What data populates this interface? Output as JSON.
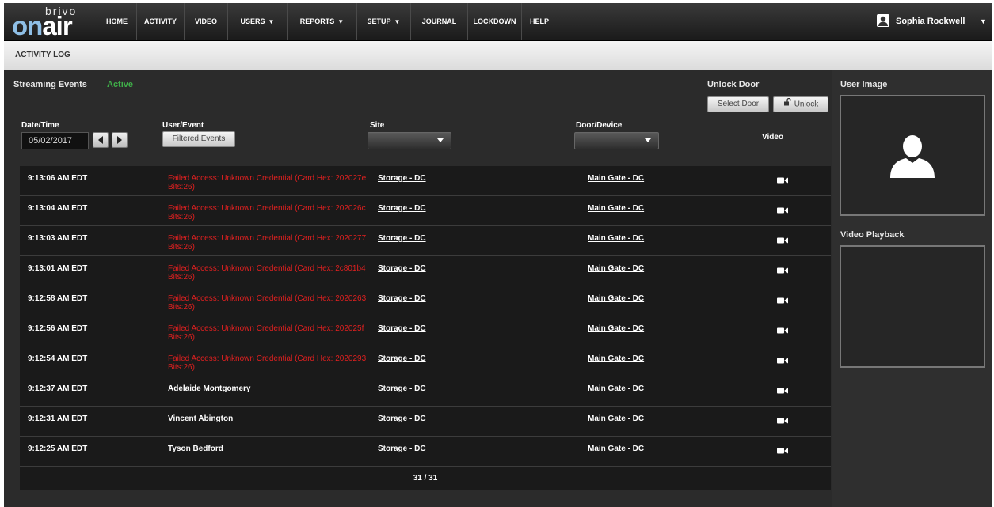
{
  "nav": {
    "brand_top": "brivo",
    "brand_on": "on",
    "brand_air": "air",
    "items": [
      {
        "label": "HOME",
        "caret": ""
      },
      {
        "label": "ACTIVITY",
        "caret": ""
      },
      {
        "label": "VIDEO",
        "caret": ""
      },
      {
        "label": "USERS",
        "caret": "▼"
      },
      {
        "label": "REPORTS",
        "caret": "▼"
      },
      {
        "label": "SETUP",
        "caret": "▼"
      },
      {
        "label": "JOURNAL",
        "caret": ""
      },
      {
        "label": "LOCKDOWN",
        "caret": ""
      },
      {
        "label": "HELP",
        "caret": ""
      }
    ],
    "user_name": "Sophia Rockwell",
    "user_caret": "▼"
  },
  "page": {
    "title": "ACTIVITY LOG"
  },
  "streaming": {
    "label": "Streaming Events",
    "status": "Active"
  },
  "unlock": {
    "title": "Unlock Door",
    "select_label": "Select Door",
    "unlock_label": "Unlock"
  },
  "filters": {
    "date_label": "Date/Time",
    "date_value": "05/02/2017",
    "user_event_label": "User/Event",
    "filtered_label": "Filtered Events",
    "site_label": "Site",
    "door_label": "Door/Device",
    "video_label": "Video"
  },
  "rows": [
    {
      "time": "9:13:06 AM EDT",
      "event": "Failed Access: Unknown Credential (Card Hex: 202027e Bits:26)",
      "type": "failed",
      "site": "Storage - DC",
      "door": "Main Gate - DC"
    },
    {
      "time": "9:13:04 AM EDT",
      "event": "Failed Access: Unknown Credential (Card Hex: 202026c Bits:26)",
      "type": "failed",
      "site": "Storage - DC",
      "door": "Main Gate - DC"
    },
    {
      "time": "9:13:03 AM EDT",
      "event": "Failed Access: Unknown Credential (Card Hex: 2020277 Bits:26)",
      "type": "failed",
      "site": "Storage - DC",
      "door": "Main Gate - DC"
    },
    {
      "time": "9:13:01 AM EDT",
      "event": "Failed Access: Unknown Credential (Card Hex: 2c801b4 Bits:26)",
      "type": "failed",
      "site": "Storage - DC",
      "door": "Main Gate - DC"
    },
    {
      "time": "9:12:58 AM EDT",
      "event": "Failed Access: Unknown Credential (Card Hex: 2020263 Bits:26)",
      "type": "failed",
      "site": "Storage - DC",
      "door": "Main Gate - DC"
    },
    {
      "time": "9:12:56 AM EDT",
      "event": "Failed Access: Unknown Credential (Card Hex: 202025f Bits:26)",
      "type": "failed",
      "site": "Storage - DC",
      "door": "Main Gate - DC"
    },
    {
      "time": "9:12:54 AM EDT",
      "event": "Failed Access: Unknown Credential (Card Hex: 2020293 Bits:26)",
      "type": "failed",
      "site": "Storage - DC",
      "door": "Main Gate - DC"
    },
    {
      "time": "9:12:37 AM EDT",
      "event": "Adelaide Montgomery",
      "type": "user",
      "site": "Storage - DC",
      "door": "Main Gate - DC"
    },
    {
      "time": "9:12:31 AM EDT",
      "event": "Vincent Abington",
      "type": "user",
      "site": "Storage - DC",
      "door": "Main Gate - DC"
    },
    {
      "time": "9:12:25 AM EDT",
      "event": "Tyson Bedford",
      "type": "user",
      "site": "Storage - DC",
      "door": "Main Gate - DC"
    }
  ],
  "pager": {
    "text": "31 / 31"
  },
  "side": {
    "user_image_title": "User Image",
    "video_title": "Video Playback"
  },
  "colors": {
    "active_green": "#3fae49",
    "failed_red": "#e02020"
  },
  "icons": [
    "user-silhouette-icon",
    "video-camera-icon",
    "lock-open-icon",
    "arrow-left-icon",
    "arrow-right-icon"
  ]
}
